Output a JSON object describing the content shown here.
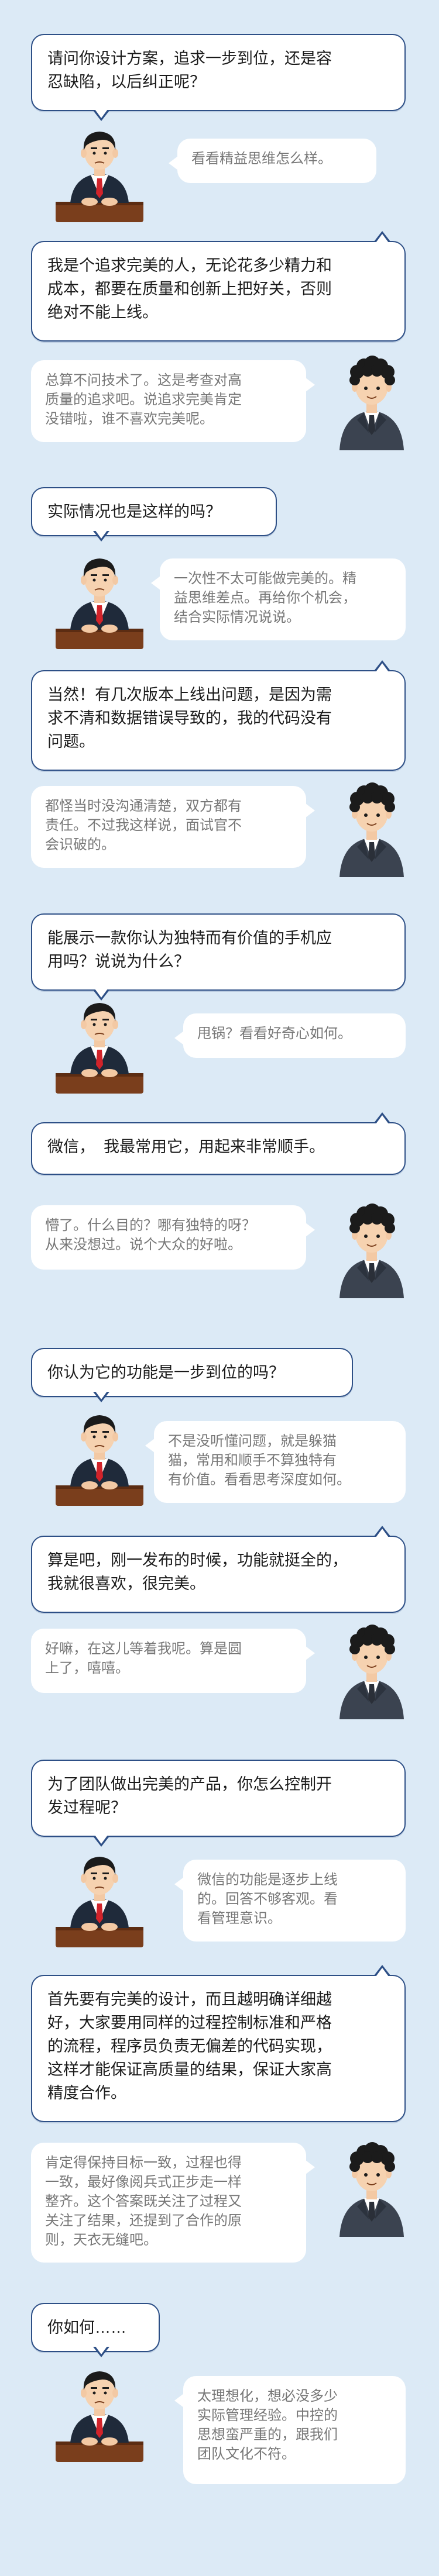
{
  "conversation": [
    {
      "speaker": "interviewer",
      "text": "请问你设计方案，追求一步到位，还是容\n忍缺陷，以后纠正呢？"
    },
    {
      "speaker": "interviewer_note",
      "text": "看看精益思维怎么样。"
    },
    {
      "speaker": "candidate",
      "text": "我是个追求完美的人，无论花多少精力和\n成本，都要在质量和创新上把好关，否则\n绝对不能上线。"
    },
    {
      "speaker": "candidate_note",
      "text": "总算不问技术了。这是考查对高\n质量的追求吧。说追求完美肯定\n没错啦，谁不喜欢完美呢。"
    },
    {
      "speaker": "interviewer",
      "text": "实际情况也是这样的吗？"
    },
    {
      "speaker": "interviewer_note",
      "text": "一次性不太可能做完美的。精\n益思维差点。再给你个机会，\n结合实际情况说说。"
    },
    {
      "speaker": "candidate",
      "text": "当然！有几次版本上线出问题，是因为需\n求不清和数据错误导致的，我的代码没有\n问题。"
    },
    {
      "speaker": "candidate_note",
      "text": "都怪当时没沟通清楚，双方都有\n责任。不过我这样说，面试官不\n会识破的。"
    },
    {
      "speaker": "interviewer",
      "text": "能展示一款你认为独特而有价值的手机应\n用吗？说说为什么？"
    },
    {
      "speaker": "interviewer_note",
      "text": "甩锅？看看好奇心如何。"
    },
    {
      "speaker": "candidate",
      "text": "微信，  我最常用它，用起来非常顺手。"
    },
    {
      "speaker": "candidate_note",
      "text": "懵了。什么目的？哪有独特的呀？\n从来没想过。说个大众的好啦。"
    },
    {
      "speaker": "interviewer",
      "text": "你认为它的功能是一步到位的吗？"
    },
    {
      "speaker": "interviewer_note",
      "text": "不是没听懂问题，就是躲猫\n猫，常用和顺手不算独特有\n有价值。看看思考深度如何。"
    },
    {
      "speaker": "candidate",
      "text": "算是吧，刚一发布的时候，功能就挺全的，\n我就很喜欢，很完美。"
    },
    {
      "speaker": "candidate_note",
      "text": "好嘛，在这儿等着我呢。算是圆\n上了，嘻嘻。"
    },
    {
      "speaker": "interviewer",
      "text": "为了团队做出完美的产品，你怎么控制开\n发过程呢？"
    },
    {
      "speaker": "interviewer_note",
      "text": "微信的功能是逐步上线\n的。回答不够客观。看\n看管理意识。"
    },
    {
      "speaker": "candidate",
      "text": "首先要有完美的设计，而且越明确详细越\n好，大家要用同样的过程控制标准和严格\n的流程，程序员负责无偏差的代码实现，\n这样才能保证高质量的结果，保证大家高\n精度合作。"
    },
    {
      "speaker": "candidate_note",
      "text": "肯定得保持目标一致，过程也得\n一致，最好像阅兵式正步走一样\n整齐。这个答案既关注了过程又\n关注了结果，还提到了合作的原\n则，天衣无缝吧。"
    },
    {
      "speaker": "interviewer",
      "text": "你如何……"
    },
    {
      "speaker": "interviewer_note",
      "text": "太理想化，想必没多少\n实际管理经验。中控的\n思想蛮严重的，跟我们\n团队文化不符。"
    }
  ],
  "colors": {
    "background": "#dceaf6",
    "bubble_border": "#2d4f86",
    "note_text": "#777777",
    "interviewer_suit": "#1f2a3a",
    "interviewer_tie": "#d2232a",
    "candidate_suit": "#3b4350",
    "desk": "#7a3e1c"
  },
  "icons": {
    "interviewer": "interviewer-avatar-icon",
    "candidate": "candidate-avatar-icon"
  }
}
